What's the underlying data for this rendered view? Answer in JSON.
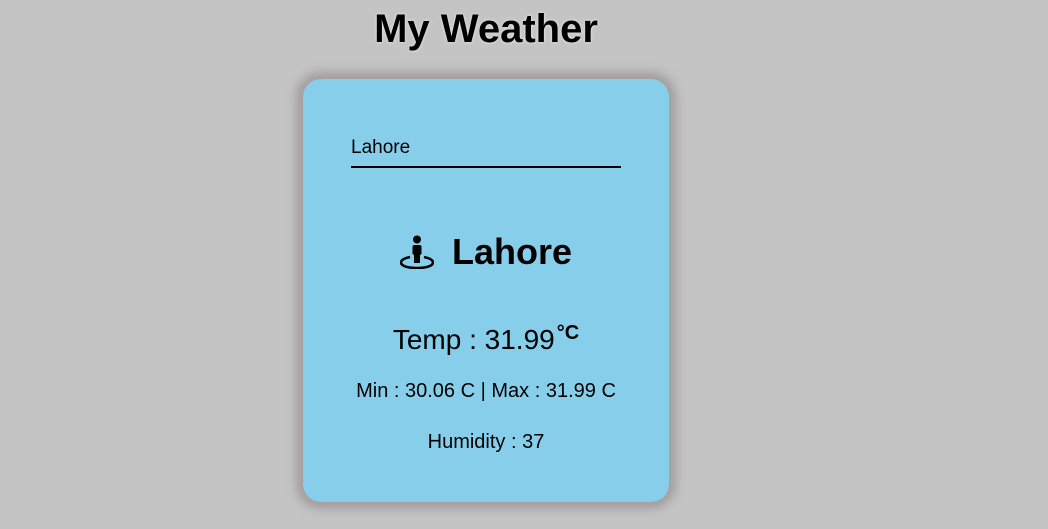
{
  "page": {
    "title": "My Weather"
  },
  "colors": {
    "background": "#c4c4c4",
    "card": "#87ceeb",
    "card_shadow": "#a49d9d",
    "text": "#000000"
  },
  "search": {
    "value": "Lahore"
  },
  "weather": {
    "location_icon": "street-view-icon",
    "city": "Lahore",
    "temp_label": "Temp : ",
    "temp_value": "31.99",
    "temp_unit": "°C",
    "min_label": "Min : ",
    "min_value": "30.06",
    "min_unit": " C",
    "separator": " | ",
    "max_label": "Max : ",
    "max_value": "31.99",
    "max_unit": " C",
    "humidity_label": "Humidity : ",
    "humidity_value": "37"
  }
}
